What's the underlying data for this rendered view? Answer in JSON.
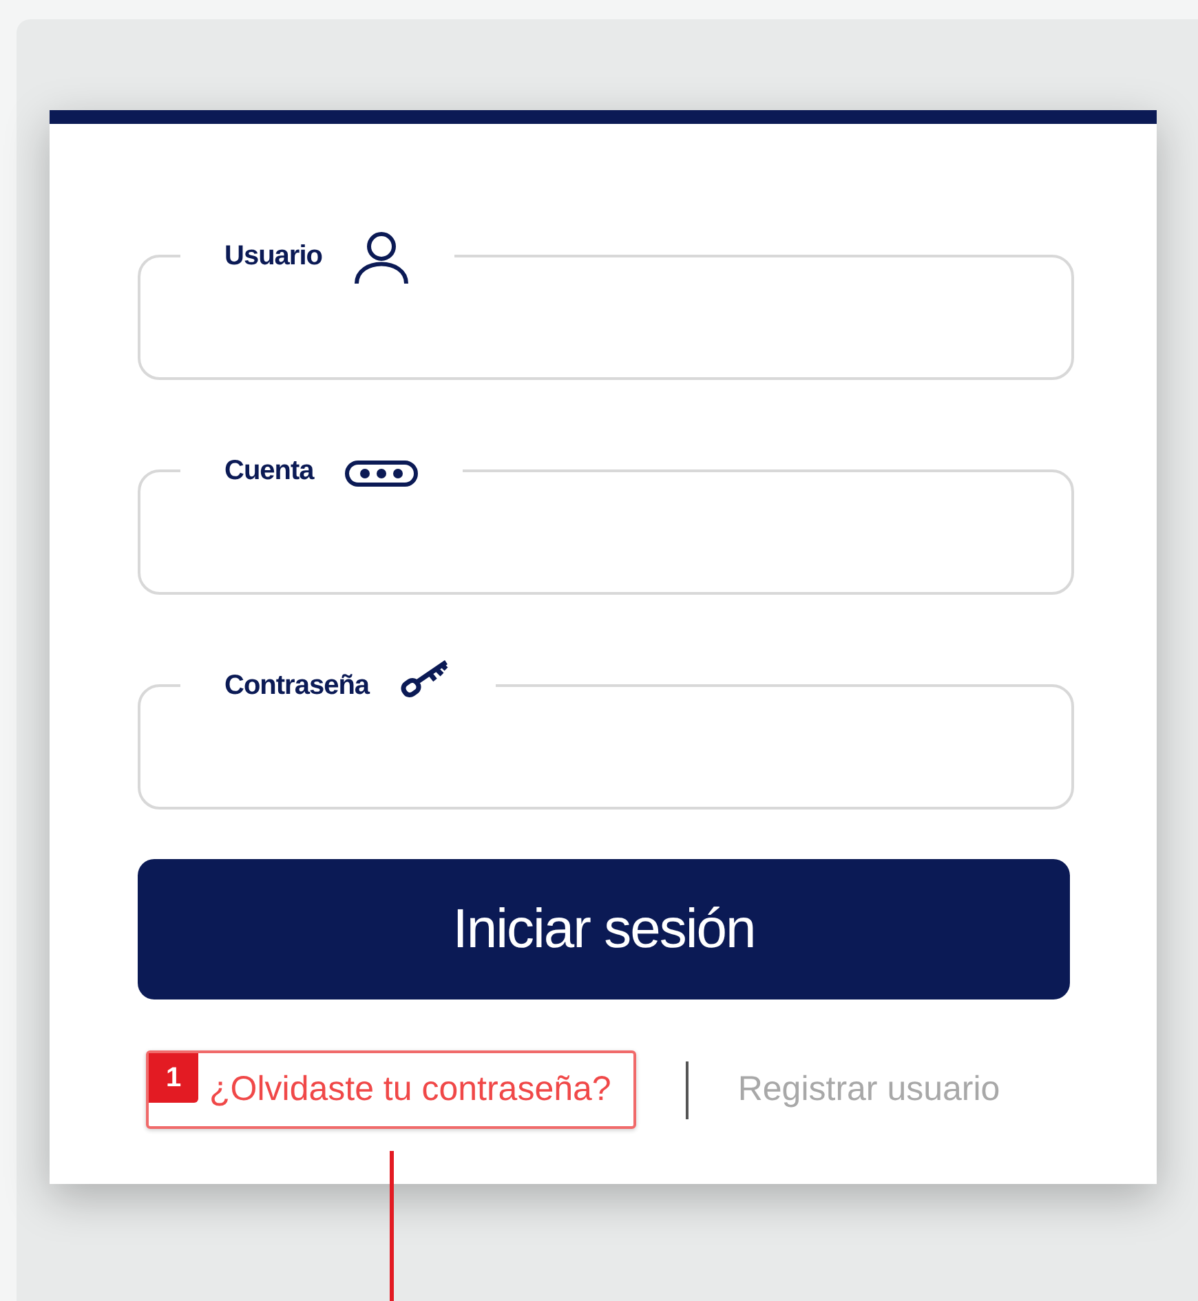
{
  "fields": [
    {
      "kind": "user",
      "label": "Usuario"
    },
    {
      "kind": "account",
      "label": "Cuenta"
    },
    {
      "kind": "password",
      "label": "Contraseña"
    }
  ],
  "submit_button": "Iniciar sesión",
  "links": [
    {
      "label": "¿Olvidaste tu contraseña?",
      "annotated": true
    },
    {
      "label": "Registrar usuario",
      "annotated": false
    }
  ],
  "annotation_badge": "1"
}
